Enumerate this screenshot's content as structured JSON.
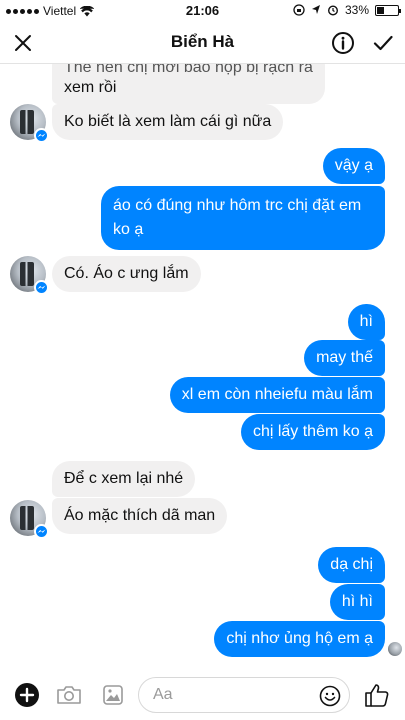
{
  "status_bar": {
    "carrier": "Viettel",
    "time": "21:06",
    "battery": "33%"
  },
  "header": {
    "title": "Biển Hà"
  },
  "messages": [
    {
      "from": "them",
      "text": "Thế nên chị mới bảo hộp bị rạch rá"
    },
    {
      "from": "them",
      "text": "xem rồi"
    },
    {
      "from": "them",
      "text": "Ko biết là xem làm cái gì nữa"
    },
    {
      "from": "me",
      "text": "vậy ạ"
    },
    {
      "from": "me",
      "text": "áo có đúng như hôm trc chị đặt em"
    },
    {
      "from": "me",
      "text": "ko ạ"
    },
    {
      "from": "them",
      "text": "Có. Áo c ưng lắm"
    },
    {
      "from": "me",
      "text": "hì"
    },
    {
      "from": "me",
      "text": "may thế"
    },
    {
      "from": "me",
      "text": "xl em còn nheiefu màu lắm"
    },
    {
      "from": "me",
      "text": "chị lấy thêm ko ạ"
    },
    {
      "from": "them",
      "text": "Để c xem lại nhé"
    },
    {
      "from": "them",
      "text": "Áo mặc thích dã man"
    },
    {
      "from": "me",
      "text": "dạ chị"
    },
    {
      "from": "me",
      "text": "hì hì"
    },
    {
      "from": "me",
      "text": "chị nhơ ủng hộ em ạ"
    }
  ],
  "composer": {
    "placeholder": "Aa"
  },
  "colors": {
    "accent": "#0084ff",
    "incoming_bubble": "#f1f0f0"
  },
  "icons": [
    "wifi-icon",
    "lock-rotation-icon",
    "location-icon",
    "alarm-icon",
    "close-icon",
    "info-icon",
    "checkmark-icon",
    "plus-icon",
    "camera-icon",
    "image-icon",
    "emoji-icon",
    "like-icon",
    "messenger-badge-icon"
  ]
}
